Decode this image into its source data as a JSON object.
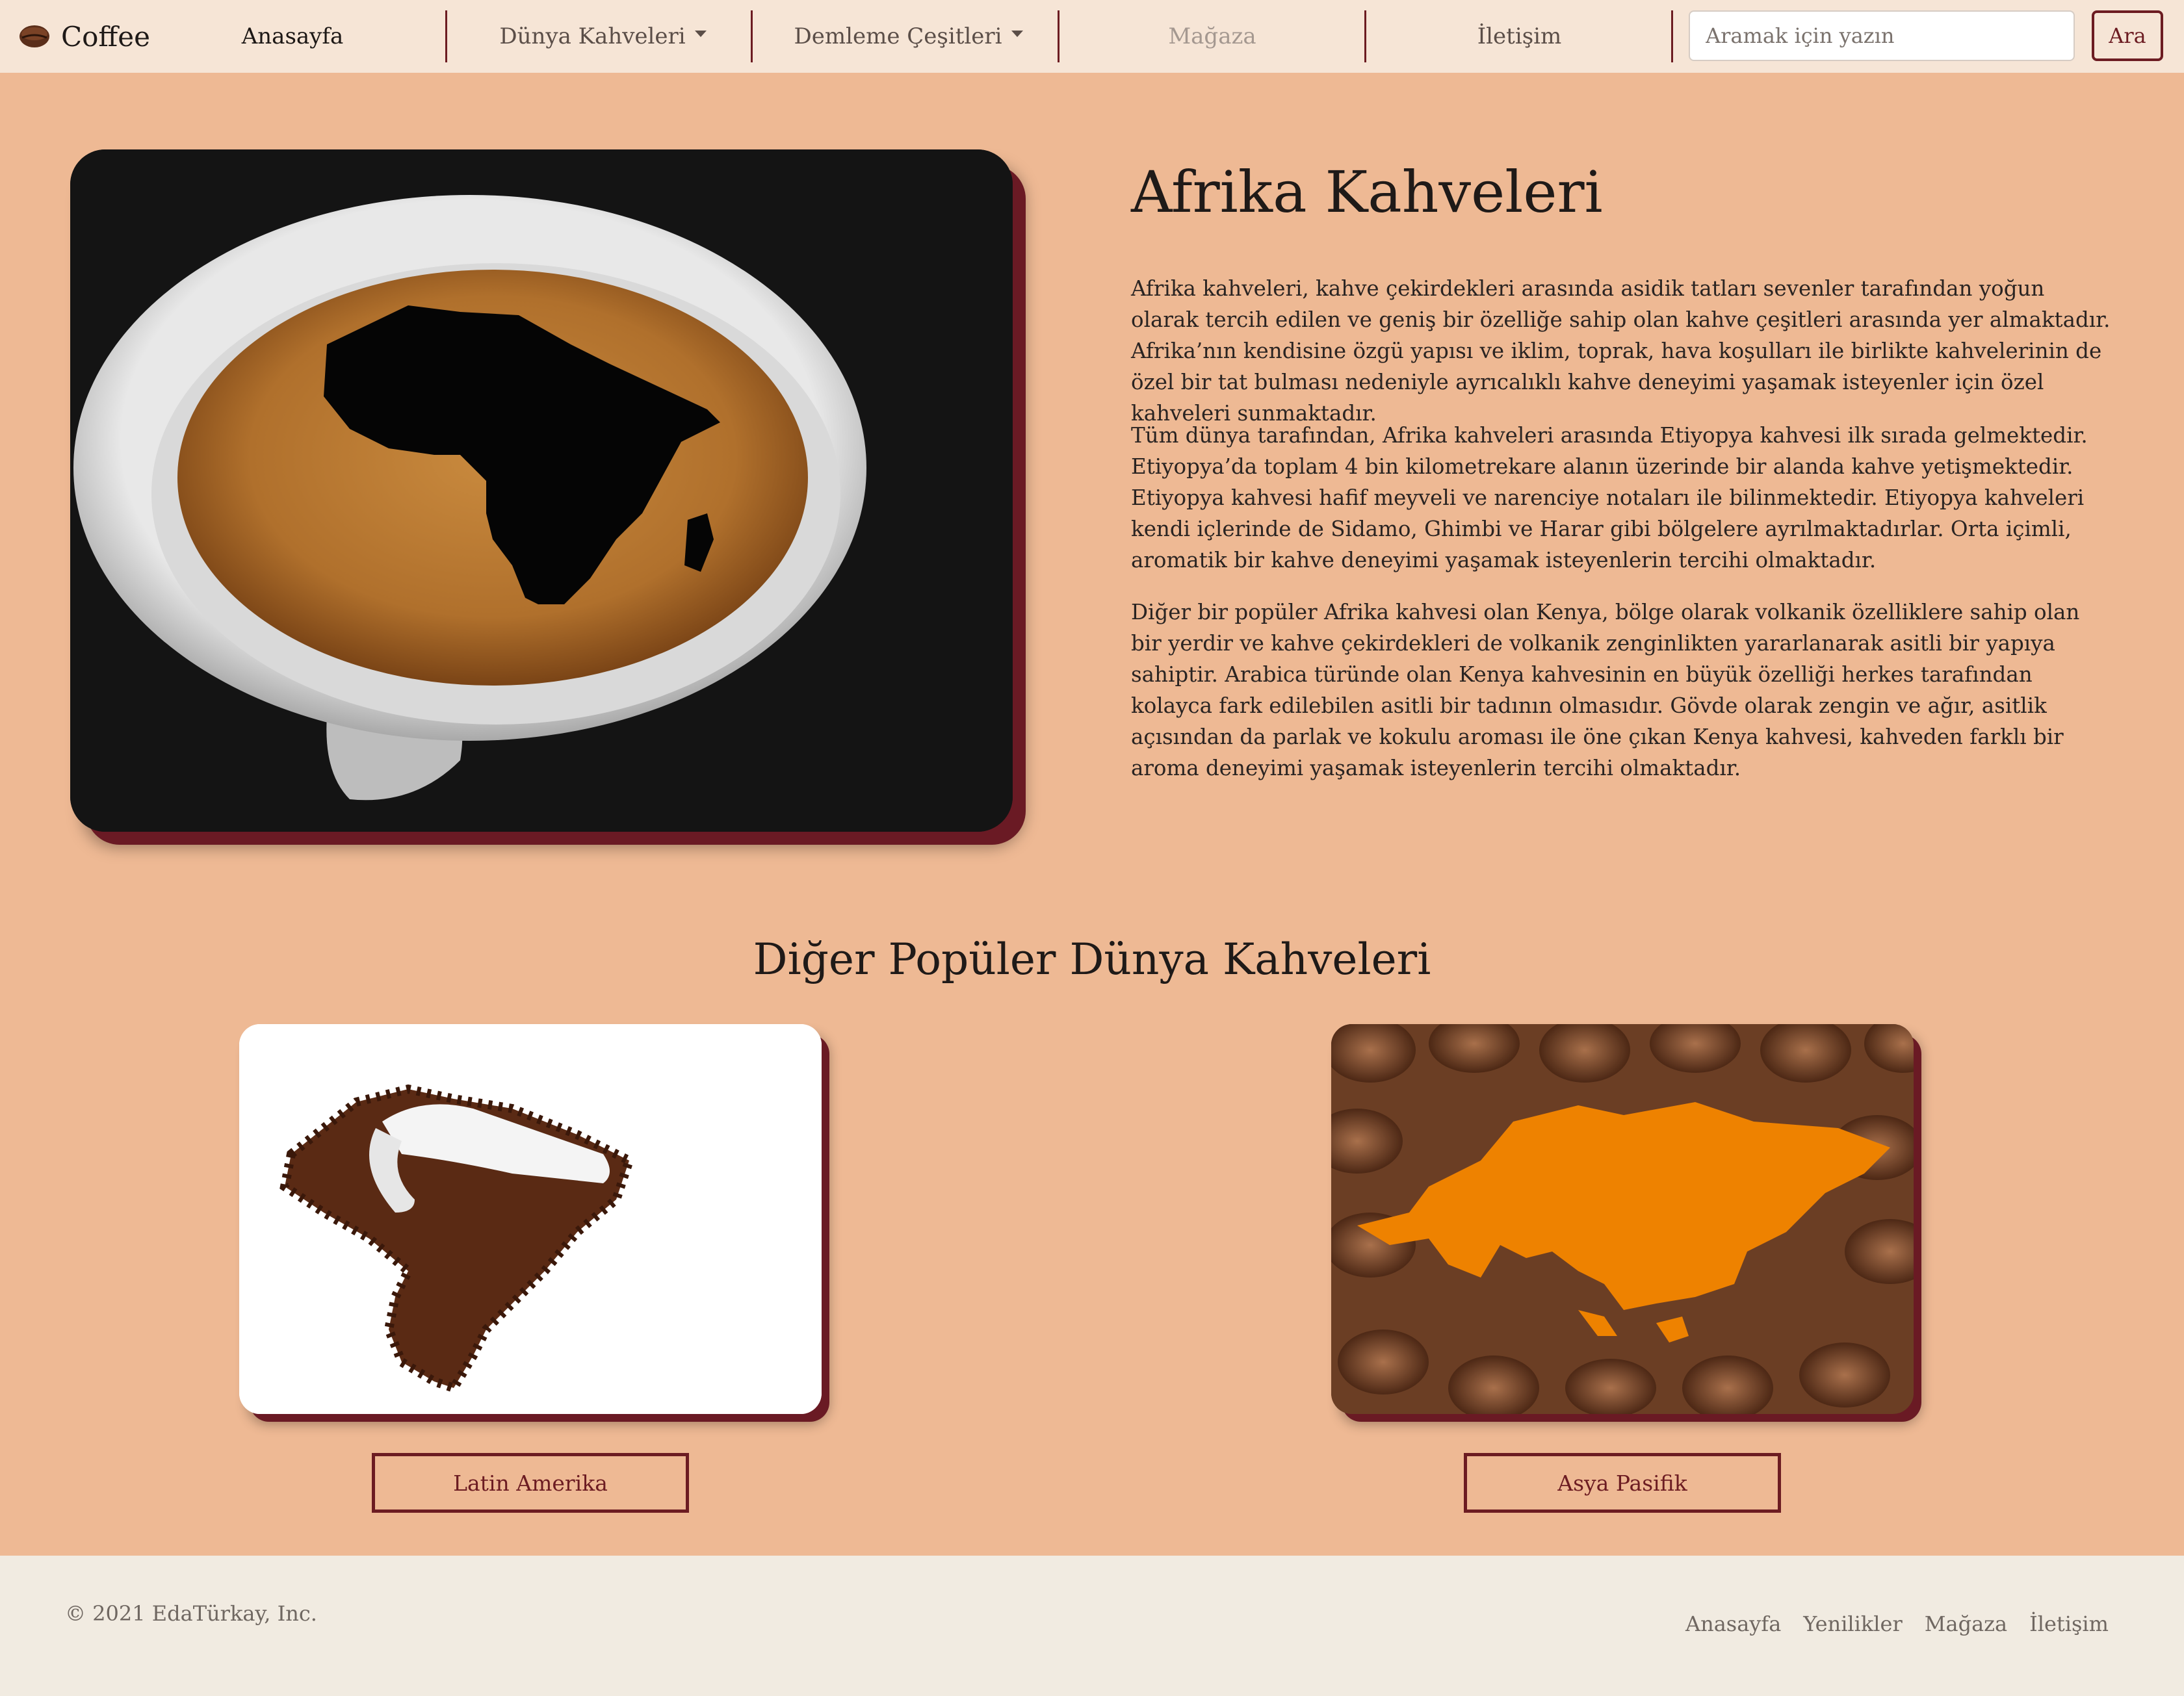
{
  "navbar": {
    "brand": "Coffee",
    "brand_icon": "coffee-bean-icon",
    "items": [
      {
        "label": "Anasayfa",
        "state": "active"
      },
      {
        "label": "Dünya Kahveleri",
        "dropdown": true
      },
      {
        "label": "Demleme Çeşitleri",
        "dropdown": true
      },
      {
        "label": "Mağaza",
        "state": "disabled"
      },
      {
        "label": "İletişim"
      }
    ],
    "search": {
      "placeholder": "Aramak için yazın",
      "button": "Ara"
    }
  },
  "hero": {
    "image_alt": "Afrika haritalı kahve fincanı",
    "title": "Afrika Kahveleri",
    "paragraphs": [
      "Afrika kahveleri, kahve çekirdekleri arasında asidik tatları sevenler tarafından yoğun olarak tercih edilen ve geniş bir özelliğe sahip olan kahve çeşitleri arasında yer almaktadır. Afrika’nın kendisine özgü yapısı ve iklim, toprak, hava koşulları ile birlikte kahvelerinin de özel bir tat bulması nedeniyle ayrıcalıklı kahve deneyimi yaşamak isteyenler için özel kahveleri sunmaktadır.",
      "Tüm dünya tarafından, Afrika kahveleri arasında Etiyopya kahvesi ilk sırada gelmektedir. Etiyopya’da toplam 4 bin kilometrekare alanın üzerinde bir alanda kahve yetişmektedir. Etiyopya kahvesi hafif meyveli ve narenciye notaları ile bilinmektedir. Etiyopya kahveleri kendi içlerinde de Sidamo, Ghimbi ve Harar gibi bölgelere ayrılmaktadırlar. Orta içimli, aromatik bir kahve deneyimi yaşamak isteyenlerin tercihi olmaktadır.",
      "Diğer bir popüler Afrika kahvesi olan Kenya, bölge olarak volkanik özelliklere sahip olan bir yerdir ve kahve çekirdekleri de volkanik zenginlikten yararlanarak asitli bir yapıya sahiptir. Arabica türünde olan Kenya kahvesinin en büyük özelliği herkes tarafından kolayca fark edilebilen asitli bir tadının olmasıdır. Gövde olarak zengin ve ağır, asitlik açısından da parlak ve kokulu aroması ile öne çıkan Kenya kahvesi, kahveden farklı bir aroma deneyimi yaşamak isteyenlerin tercihi olmaktadır."
    ]
  },
  "popular": {
    "title": "Diğer Popüler Dünya Kahveleri",
    "cards": [
      {
        "image_alt": "Latin Amerika kahve çekirdekleri",
        "button": "Latin Amerika"
      },
      {
        "image_alt": "Asya Pasifik haritası",
        "button": "Asya Pasifik"
      }
    ]
  },
  "footer": {
    "copyright": "© 2021 EdaTürkay, Inc.",
    "links": [
      "Anasayfa",
      "Yenilikler",
      "Mağaza",
      "İletişim"
    ]
  },
  "colors": {
    "page_bg": "#eeb994",
    "navbar_bg": "#f6e5d6",
    "accent": "#6c1c22",
    "footer_bg": "#f1ebe1"
  }
}
